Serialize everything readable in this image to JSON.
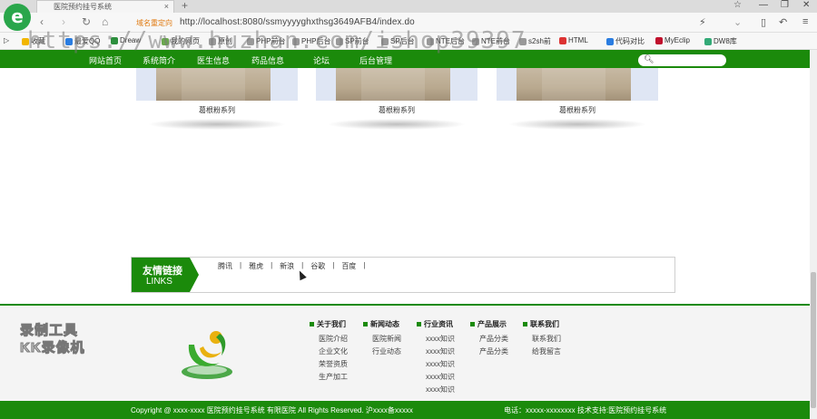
{
  "browser": {
    "tab_title": "医院预约挂号系统",
    "address_badge": "域名重定向",
    "url": "http://localhost:8080/ssmyyyyghxthsg3649AFB4/index.do",
    "bookmarks": [
      {
        "label": "收藏",
        "icon": "star-icon",
        "color": "#f2b600"
      },
      {
        "label": "最爱QQ",
        "icon": "qq-icon",
        "color": "#2a7de1"
      },
      {
        "label": "Dreaw",
        "icon": "dreamweaver-icon",
        "color": "#2c8f3d"
      },
      {
        "label": "我的网页",
        "icon": "page-icon",
        "color": "#6aa84f"
      },
      {
        "label": "原创",
        "icon": "page-icon",
        "color": "#888888"
      },
      {
        "label": "PHP前台",
        "icon": "page-icon",
        "color": "#888888"
      },
      {
        "label": "PHP后台",
        "icon": "page-icon",
        "color": "#888888"
      },
      {
        "label": "SP前台",
        "icon": "page-icon",
        "color": "#888888"
      },
      {
        "label": "SP后台",
        "icon": "page-icon",
        "color": "#888888"
      },
      {
        "label": "NTE后台",
        "icon": "page-icon",
        "color": "#888888"
      },
      {
        "label": "NTE前台",
        "icon": "page-icon",
        "color": "#888888"
      },
      {
        "label": "s2sh前",
        "icon": "page-icon",
        "color": "#888888"
      },
      {
        "label": "HTML",
        "icon": "html-icon",
        "color": "#d33"
      },
      {
        "label": "代码对比",
        "icon": "compare-icon",
        "color": "#2a7de1"
      },
      {
        "label": "MyEclip",
        "icon": "myeclipse-icon",
        "color": "#c0102c"
      },
      {
        "label": "DW8库",
        "icon": "dw-icon",
        "color": "#3a7"
      }
    ],
    "watermark": "https://www.huzhan.com/ishop39397"
  },
  "site_nav": {
    "items": [
      "网站首页",
      "系统简介",
      "医生信息",
      "药品信息",
      "论坛",
      "后台管理"
    ],
    "search_placeholder": ""
  },
  "products": [
    {
      "label": "葛根粉系列"
    },
    {
      "label": "葛根粉系列"
    },
    {
      "label": "葛根粉系列"
    }
  ],
  "friend_links": {
    "title_cn": "友情链接",
    "title_en": "LINKS",
    "links": [
      "腾讯",
      "雅虎",
      "新浪",
      "谷歌",
      "百度"
    ]
  },
  "footer": {
    "watermark_lines": [
      "录制工具",
      "KK录像机"
    ],
    "columns": [
      {
        "title": "关于我们",
        "items": [
          "医院介绍",
          "企业文化",
          "荣誉资质",
          "生产加工"
        ]
      },
      {
        "title": "新闻动态",
        "items": [
          "医院新闻",
          "行业动态"
        ]
      },
      {
        "title": "行业资讯",
        "items": [
          "xxxx知识",
          "xxxx知识",
          "xxxx知识",
          "xxxx知识",
          "xxxx知识"
        ]
      },
      {
        "title": "产品展示",
        "items": [
          "产品分类",
          "产品分类"
        ]
      },
      {
        "title": "联系我们",
        "items": [
          "联系我们",
          "给我留言"
        ]
      }
    ],
    "copyright": "Copyright @ xxxx-xxxx 医院预约挂号系统 有限医院 All Rights Reserved.  沪xxxx备xxxxx",
    "contact": "电话：xxxxx-xxxxxxxx   技术支持:医院预约挂号系统"
  }
}
